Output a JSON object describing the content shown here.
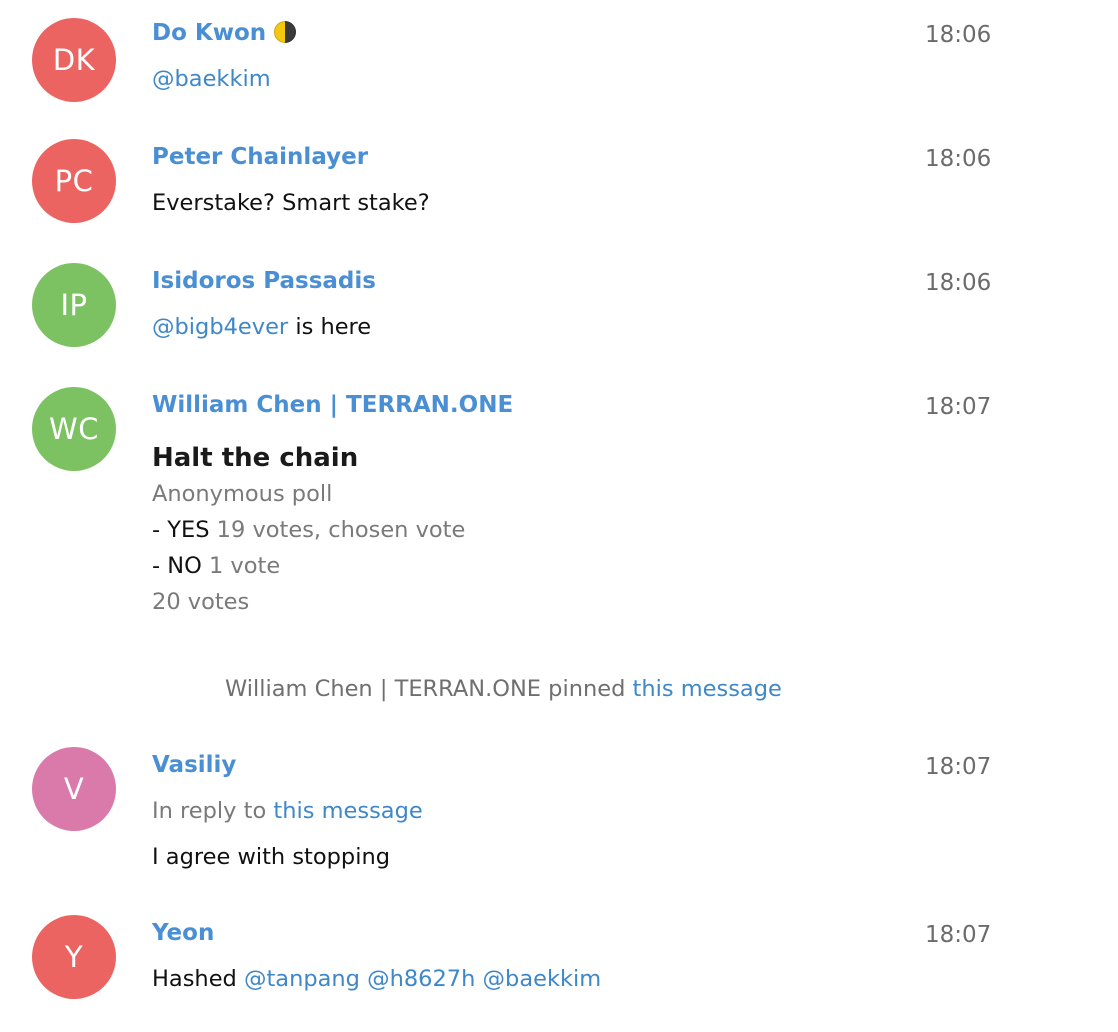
{
  "messages": [
    {
      "initials": "DK",
      "avatar_color": "#ec6461",
      "name": "Do Kwon",
      "name_icon": "moon-icon",
      "time": "18:06",
      "text": "@baekkim"
    },
    {
      "initials": "PC",
      "avatar_color": "#ec6461",
      "name": "Peter Chainlayer",
      "time": "18:06",
      "text": "Everstake? Smart stake?"
    },
    {
      "initials": "IP",
      "avatar_color": "#7cc262",
      "name": "Isidoros Passadis",
      "time": "18:06",
      "mention": "@bigb4ever",
      "text": " is here"
    },
    {
      "initials": "WC",
      "avatar_color": "#7cc262",
      "name": "William Chen | TERRAN.ONE",
      "time": "18:07",
      "poll": {
        "question": "Halt the chain",
        "type": "Anonymous poll",
        "options": [
          {
            "prefix": "- YES",
            "detail": " 19 votes, chosen vote"
          },
          {
            "prefix": "- NO",
            "detail": " 1 vote"
          }
        ],
        "total": "20 votes"
      }
    }
  ],
  "pinned_notice": {
    "actor": "William Chen | TERRAN.ONE pinned ",
    "link": "this message"
  },
  "replies": [
    {
      "initials": "V",
      "avatar_color": "#d97aaa",
      "name": "Vasiliy",
      "time": "18:07",
      "reply_prefix": "In reply to ",
      "reply_link": "this message",
      "text": "I agree with stopping"
    },
    {
      "initials": "Y",
      "avatar_color": "#ec6461",
      "name": "Yeon",
      "time": "18:07",
      "text": "Hashed ",
      "mentions": "@tanpang @h8627h @baekkim"
    }
  ]
}
